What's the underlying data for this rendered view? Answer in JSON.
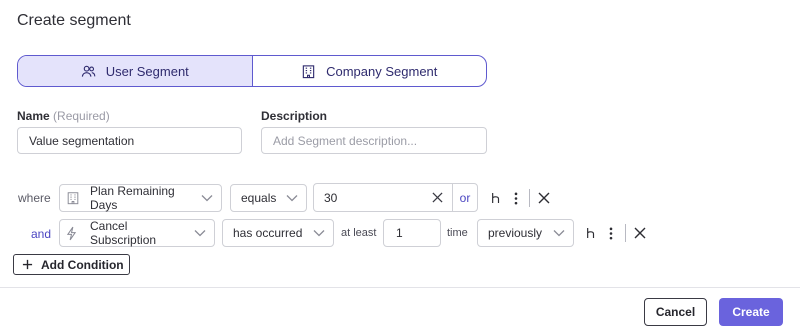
{
  "dialog": {
    "title": "Create segment"
  },
  "segment_type": {
    "options": [
      {
        "label": "User Segment",
        "icon": "users-icon",
        "selected": true
      },
      {
        "label": "Company Segment",
        "icon": "building-icon",
        "selected": false
      }
    ]
  },
  "form": {
    "name": {
      "label": "Name",
      "hint": "(Required)",
      "value": "Value segmentation"
    },
    "description": {
      "label": "Description",
      "placeholder": "Add Segment description..."
    }
  },
  "conditions": [
    {
      "connector": "where",
      "property": {
        "label": "Plan Remaining Days",
        "icon": "building-icon"
      },
      "operator": "equals",
      "value": "30",
      "or_label": "or"
    },
    {
      "connector": "and",
      "property": {
        "label": "Cancel Subscription",
        "icon": "lightning-icon"
      },
      "operator": "has occurred",
      "at_least_label": "at least",
      "count": "1",
      "time_label": "time",
      "time_range": "previously"
    }
  ],
  "actions": {
    "add_condition": "Add Condition",
    "cancel": "Cancel",
    "create": "Create"
  },
  "colors": {
    "accent": "#6a63dd",
    "accent_light": "#e4e3fb",
    "link": "#4b46c2"
  }
}
